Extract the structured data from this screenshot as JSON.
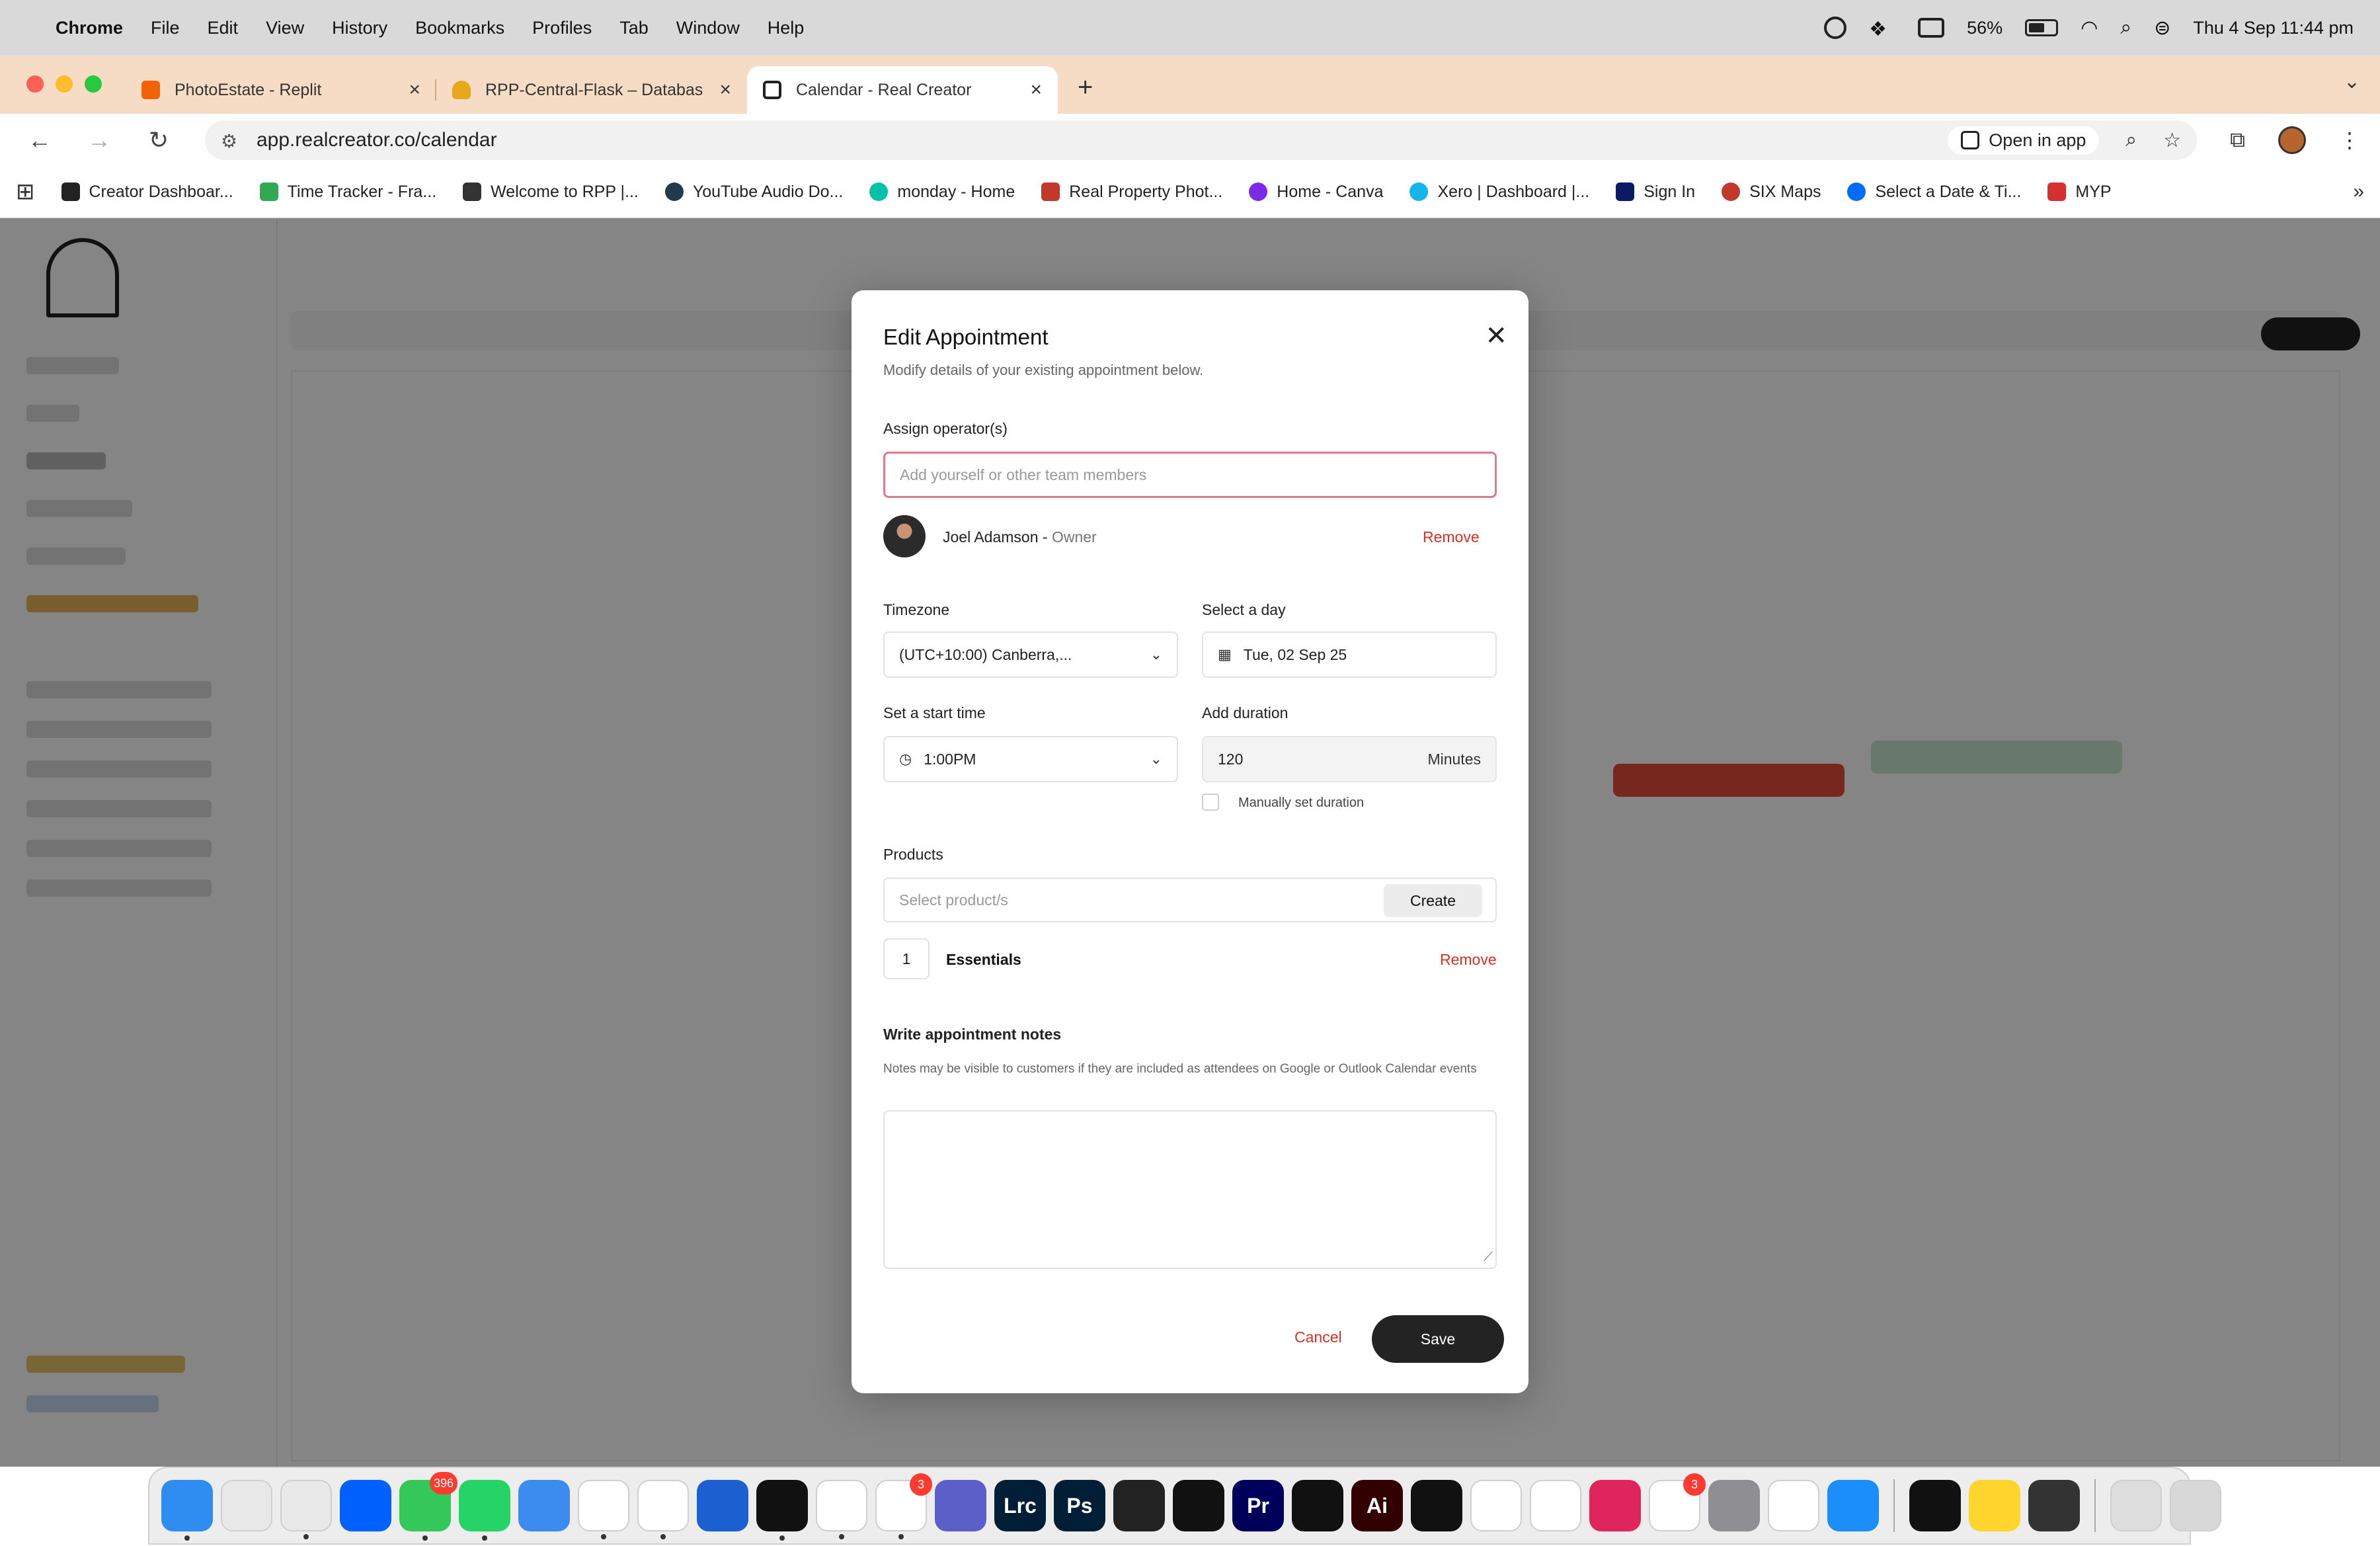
{
  "menubar": {
    "apple_icon": "apple-icon",
    "items": [
      "Chrome",
      "File",
      "Edit",
      "View",
      "History",
      "Bookmarks",
      "Profiles",
      "Tab",
      "Window",
      "Help"
    ],
    "battery": "56%",
    "clock": "Thu 4 Sep  11:44 pm"
  },
  "tabs": [
    {
      "title": "PhotoEstate - Replit",
      "color": "#f26207"
    },
    {
      "title": "RPP-Central-Flask – Databas",
      "color": "#e8a81b"
    },
    {
      "title": "Calendar - Real Creator",
      "color": "#222222"
    }
  ],
  "address_bar": {
    "url": "app.realcreator.co/calendar",
    "open_in_app": "Open in app"
  },
  "bookmarks": [
    {
      "label": "Creator Dashboar...",
      "color": "#222222"
    },
    {
      "label": "Time Tracker - Fra...",
      "color": "#31a853"
    },
    {
      "label": "Welcome to RPP |...",
      "color": "#333333"
    },
    {
      "label": "YouTube Audio Do...",
      "color": "#1f3b4d"
    },
    {
      "label": "monday - Home",
      "color": "#00c2a8"
    },
    {
      "label": "Real Property Phot...",
      "color": "#c0392b"
    },
    {
      "label": "Home - Canva",
      "color": "#7d2ae8"
    },
    {
      "label": "Xero | Dashboard |...",
      "color": "#13b5ea"
    },
    {
      "label": "Sign In",
      "color": "#0c1a66"
    },
    {
      "label": "SIX Maps",
      "color": "#c0392b"
    },
    {
      "label": "Select a Date & Ti...",
      "color": "#006bff"
    },
    {
      "label": "MYP",
      "color": "#d63031"
    }
  ],
  "modal": {
    "title": "Edit Appointment",
    "subtitle": "Modify details of your existing appointment below.",
    "assign_label": "Assign operator(s)",
    "assign_placeholder": "Add yourself or other team members",
    "operator": {
      "name": "Joel Adamson",
      "separator": " - ",
      "role": "Owner",
      "remove": "Remove"
    },
    "timezone_label": "Timezone",
    "timezone_value": "(UTC+10:00) Canberra,...",
    "day_label": "Select a day",
    "day_value": "Tue, 02 Sep 25",
    "start_label": "Set a start time",
    "start_value": "1:00PM",
    "duration_label": "Add duration",
    "duration_value": "120",
    "duration_unit": "Minutes",
    "manual_duration_label": "Manually set duration",
    "products_label": "Products",
    "products_placeholder": "Select product/s",
    "create_label": "Create",
    "product_qty": "1",
    "product_name": "Essentials",
    "product_remove": "Remove",
    "notes_label": "Write appointment notes",
    "notes_hint": "Notes may be visible to customers if they are included as attendees on Google or Outlook Calendar events",
    "notes_value": "",
    "cancel_label": "Cancel",
    "save_label": "Save"
  },
  "dock": [
    {
      "name": "finder-icon",
      "color": "#2f8cf0",
      "running": true
    },
    {
      "name": "launchpad-icon",
      "color": "#e8e8e8",
      "running": false
    },
    {
      "name": "chrome-icon",
      "color": "#e8e8e8",
      "running": true
    },
    {
      "name": "dropbox-icon",
      "color": "#0061fe",
      "running": false
    },
    {
      "name": "messages-icon",
      "color": "#34c759",
      "running": true,
      "badge": "396"
    },
    {
      "name": "whatsapp-icon",
      "color": "#25d366",
      "running": true
    },
    {
      "name": "mail-icon",
      "color": "#3c8cf0",
      "running": false
    },
    {
      "name": "real-creator-icon",
      "color": "#ffffff",
      "running": true
    },
    {
      "name": "monday-icon",
      "color": "#ffffff",
      "running": true
    },
    {
      "name": "audio-icon",
      "color": "#1b5fd0",
      "running": false
    },
    {
      "name": "wave-icon",
      "color": "#111111",
      "running": true
    },
    {
      "name": "slack-icon",
      "color": "#ffffff",
      "running": true
    },
    {
      "name": "messenger-icon",
      "color": "#ffffff",
      "running": true,
      "badge": "3"
    },
    {
      "name": "teams-icon",
      "color": "#5b5fc7",
      "running": false
    },
    {
      "name": "lightroom-icon",
      "color": "#001e36",
      "running": false,
      "text": "Lrc"
    },
    {
      "name": "photoshop-icon",
      "color": "#001e36",
      "running": false,
      "text": "Ps"
    },
    {
      "name": "quicktime-icon",
      "color": "#222222",
      "running": false
    },
    {
      "name": "final-cut-icon",
      "color": "#111111",
      "running": false
    },
    {
      "name": "premiere-icon",
      "color": "#00005b",
      "running": false,
      "text": "Pr"
    },
    {
      "name": "claude-icon",
      "color": "#111111",
      "running": false
    },
    {
      "name": "illustrator-icon",
      "color": "#330000",
      "running": false,
      "text": "Ai"
    },
    {
      "name": "perplexity-icon",
      "color": "#111111",
      "running": false
    },
    {
      "name": "font-icon",
      "color": "#ffffff",
      "running": false
    },
    {
      "name": "chatgpt-icon",
      "color": "#ffffff",
      "running": false
    },
    {
      "name": "creative-cloud-icon",
      "color": "#e0245e",
      "running": false
    },
    {
      "name": "reminders-icon",
      "color": "#ffffff",
      "running": false,
      "badge": "3"
    },
    {
      "name": "system-settings-icon",
      "color": "#8e8e93",
      "running": false
    },
    {
      "name": "iphone-mirroring-icon",
      "color": "#ffffff",
      "running": false
    },
    {
      "name": "app-store-icon",
      "color": "#1c8ef9",
      "running": false
    },
    {
      "name": "spotify-icon",
      "color": "#111111",
      "running": false
    },
    {
      "name": "notes-icon",
      "color": "#ffd52e",
      "running": false
    },
    {
      "name": "calculator-icon",
      "color": "#333333",
      "running": false
    },
    {
      "name": "preview-window-icon",
      "color": "#dddddd",
      "running": false
    },
    {
      "name": "trash-icon",
      "color": "#d8d8d8",
      "running": false
    }
  ]
}
